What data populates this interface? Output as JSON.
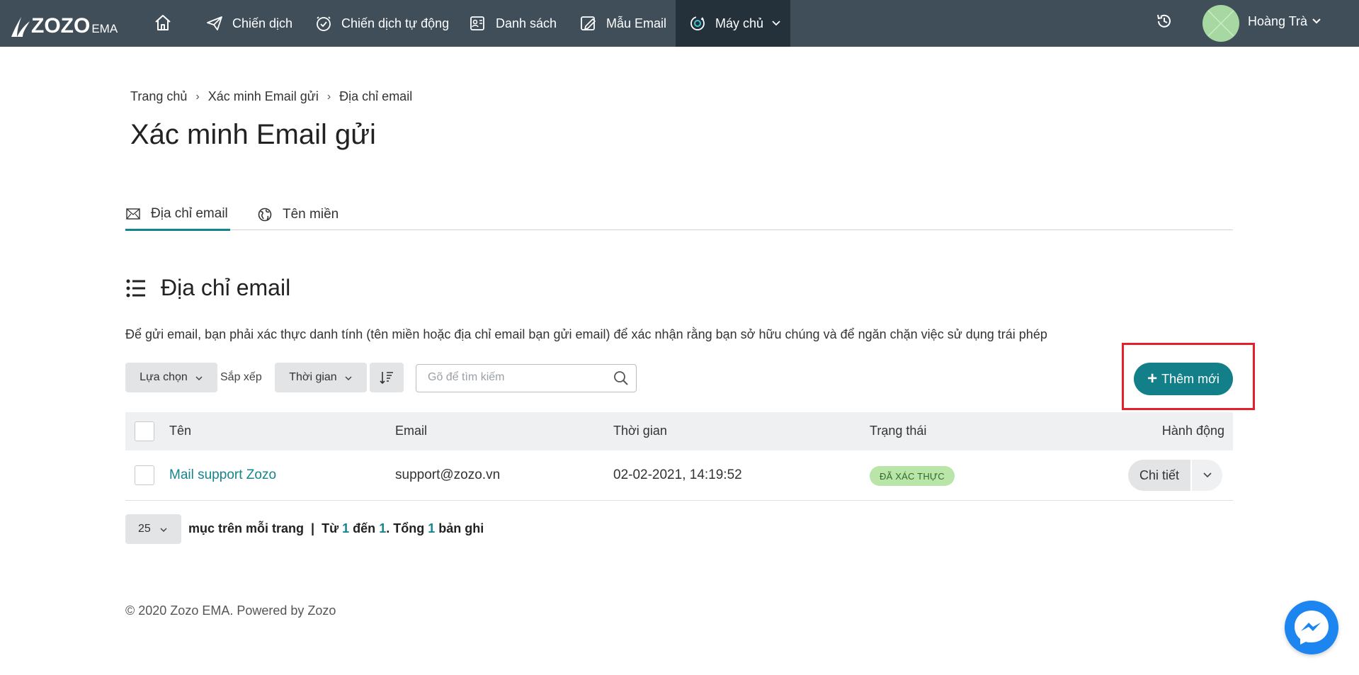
{
  "nav": {
    "logo": "ZOZO",
    "logo_sub": "EMA",
    "items": [
      {
        "label": "Chiến dịch"
      },
      {
        "label": "Chiến dịch tự động"
      },
      {
        "label": "Danh sách"
      },
      {
        "label": "Mẫu Email"
      },
      {
        "label": "Máy chủ"
      }
    ],
    "user_name": "Hoàng Trà"
  },
  "breadcrumb": [
    "Trang chủ",
    "Xác minh Email gửi",
    "Địa chỉ email"
  ],
  "page_title": "Xác minh Email gửi",
  "tabs": [
    {
      "label": "Địa chỉ email",
      "active": true
    },
    {
      "label": "Tên miền",
      "active": false
    }
  ],
  "section": {
    "title": "Địa chỉ email",
    "description": "Để gửi email, bạn phải xác thực danh tính (tên miền hoặc địa chỉ email bạn gửi email) để xác nhận rằng bạn sở hữu chúng và để ngăn chặn việc sử dụng trái phép"
  },
  "toolbar": {
    "select_label": "Lựa chọn",
    "sort_label": "Sắp xếp",
    "sort_value": "Thời gian",
    "search_placeholder": "Gõ để tìm kiếm",
    "add_label": "Thêm mới"
  },
  "table": {
    "headers": [
      "Tên",
      "Email",
      "Thời gian",
      "Trạng thái",
      "Hành động"
    ],
    "rows": [
      {
        "name": "Mail support Zozo",
        "email": "support@zozo.vn",
        "time": "02-02-2021, 14:19:52",
        "status": "ĐÃ XÁC THỰC",
        "action": "Chi tiết"
      }
    ]
  },
  "pagination": {
    "per_page": "25",
    "text_per_page": "mục trên mỗi trang",
    "text_from": "Từ",
    "from": "1",
    "text_to": "đến",
    "to": "1",
    "text_total": "Tổng",
    "total": "1",
    "text_records": "bản ghi"
  },
  "footer": "© 2020 Zozo EMA. Powered by Zozo",
  "colors": {
    "nav_bg": "#3f4e59",
    "accent": "#138089",
    "highlight": "#e5202b",
    "badge_bg": "#b9e6a8"
  }
}
